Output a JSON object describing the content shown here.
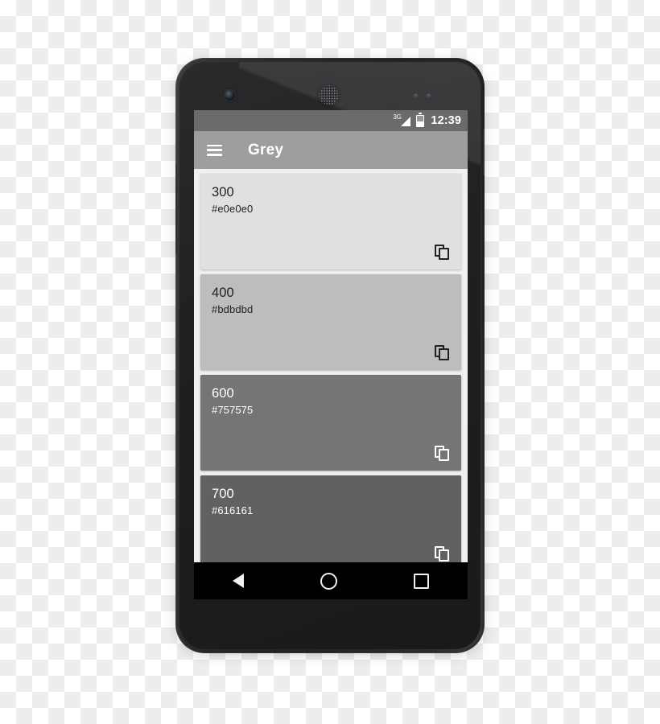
{
  "device": {
    "hardware": {
      "front_camera": "front-camera",
      "earpiece": "earpiece-speaker",
      "sensors": "proximity-sensors",
      "volume_button": "volume-rocker",
      "power_button": "power-button"
    }
  },
  "status_bar": {
    "network_label": "3G",
    "signal_icon": "signal-triangle-icon",
    "battery_icon": "battery-icon",
    "clock": "12:39"
  },
  "app_bar": {
    "menu_icon": "hamburger-menu-icon",
    "title": "Grey"
  },
  "cards": [
    {
      "name": "300",
      "hex": "#e0e0e0",
      "bg": "#e0e0e0",
      "text_color": "#212121",
      "icon_color": "#212121",
      "copy_icon": "copy-icon"
    },
    {
      "name": "400",
      "hex": "#bdbdbd",
      "bg": "#bdbdbd",
      "text_color": "#212121",
      "icon_color": "#212121",
      "copy_icon": "copy-icon"
    },
    {
      "name": "600",
      "hex": "#757575",
      "bg": "#757575",
      "text_color": "#ffffff",
      "icon_color": "#ffffff",
      "copy_icon": "copy-icon"
    },
    {
      "name": "700",
      "hex": "#616161",
      "bg": "#616161",
      "text_color": "#ffffff",
      "icon_color": "#ffffff",
      "copy_icon": "copy-icon"
    }
  ],
  "nav_bar": {
    "back": "back-triangle-icon",
    "home": "home-circle-icon",
    "recents": "recents-square-icon"
  }
}
